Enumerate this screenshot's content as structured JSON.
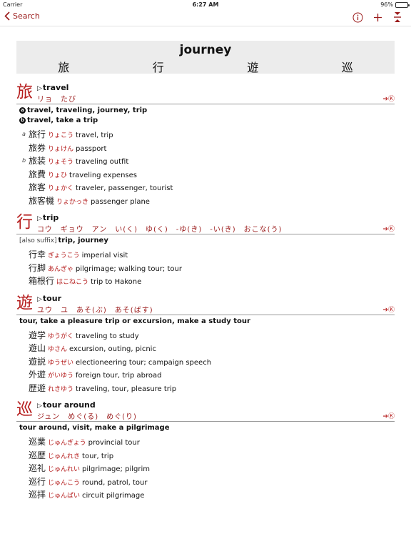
{
  "status": {
    "carrier": "Carrier",
    "time": "6:27 AM",
    "battery": "96%",
    "battery_level": 0.96
  },
  "nav": {
    "back_label": "Search"
  },
  "title": {
    "word": "journey",
    "kanji": [
      "旅",
      "行",
      "遊",
      "巡"
    ]
  },
  "colors": {
    "accent": "#b51c1c",
    "reading": "#9b1b1b"
  },
  "link_label": "➔Ⓚ",
  "entries": [
    {
      "kanji": "旅",
      "meaning": "travel",
      "readings": "リョ　たび",
      "senses": [
        {
          "num": "a",
          "note": "",
          "text": "travel, traveling, journey, trip"
        },
        {
          "num": "b",
          "note": "",
          "text": "travel, take a trip"
        }
      ],
      "compounds": [
        {
          "mark": "a",
          "word": "旅行",
          "reading": "りょこう",
          "meaning": "travel, trip"
        },
        {
          "mark": "",
          "word": "旅券",
          "reading": "りょけん",
          "meaning": "passport"
        },
        {
          "mark": "b",
          "word": "旅装",
          "reading": "りょそう",
          "meaning": "traveling outfit"
        },
        {
          "mark": "",
          "word": "旅費",
          "reading": "りょひ",
          "meaning": "traveling expenses"
        },
        {
          "mark": "",
          "word": "旅客",
          "reading": "りょかく",
          "meaning": "traveler, passenger, tourist"
        },
        {
          "mark": "",
          "word": "旅客機",
          "reading": "りょかっき",
          "meaning": "passenger plane"
        }
      ]
    },
    {
      "kanji": "行",
      "meaning": "trip",
      "readings": "コウ　ギョウ　アン　い(く)　ゆ(く)　-ゆ(き)　-い(き)　おこな(う)",
      "senses": [
        {
          "num": "",
          "note": "[also suffix]",
          "text": "trip, journey"
        }
      ],
      "compounds": [
        {
          "mark": "",
          "word": "行幸",
          "reading": "ぎょうこう",
          "meaning": "imperial visit"
        },
        {
          "mark": "",
          "word": "行脚",
          "reading": "あんぎゃ",
          "meaning": "pilgrimage; walking tour; tour"
        },
        {
          "mark": "",
          "word": "箱根行",
          "reading": "はこねこう",
          "meaning": "trip to Hakone"
        }
      ]
    },
    {
      "kanji": "遊",
      "meaning": "tour",
      "readings": "ユウ　ユ　あそ(ぶ)　あそ(ばす)",
      "senses": [
        {
          "num": "",
          "note": "",
          "text": "tour, take a pleasure trip or excursion, make a study tour"
        }
      ],
      "compounds": [
        {
          "mark": "",
          "word": "遊学",
          "reading": "ゆうがく",
          "meaning": "traveling to study"
        },
        {
          "mark": "",
          "word": "遊山",
          "reading": "ゆさん",
          "meaning": "excursion, outing, picnic"
        },
        {
          "mark": "",
          "word": "遊説",
          "reading": "ゆうぜい",
          "meaning": "electioneering tour; campaign speech"
        },
        {
          "mark": "",
          "word": "外遊",
          "reading": "がいゆう",
          "meaning": "foreign tour, trip abroad"
        },
        {
          "mark": "",
          "word": "歴遊",
          "reading": "れきゆう",
          "meaning": "traveling, tour, pleasure trip"
        }
      ]
    },
    {
      "kanji": "巡",
      "meaning": "tour around",
      "readings": "ジュン　めぐ(る)　めぐ(り)",
      "senses": [
        {
          "num": "",
          "note": "",
          "text": "tour around, visit, make a pilgrimage"
        }
      ],
      "compounds": [
        {
          "mark": "",
          "word": "巡業",
          "reading": "じゅんぎょう",
          "meaning": "provincial tour"
        },
        {
          "mark": "",
          "word": "巡歴",
          "reading": "じゅんれき",
          "meaning": "tour, trip"
        },
        {
          "mark": "",
          "word": "巡礼",
          "reading": "じゅんれい",
          "meaning": "pilgrimage; pilgrim"
        },
        {
          "mark": "",
          "word": "巡行",
          "reading": "じゅんこう",
          "meaning": "round, patrol, tour"
        },
        {
          "mark": "",
          "word": "巡拝",
          "reading": "じゅんぱい",
          "meaning": "circuit pilgrimage"
        }
      ]
    }
  ]
}
